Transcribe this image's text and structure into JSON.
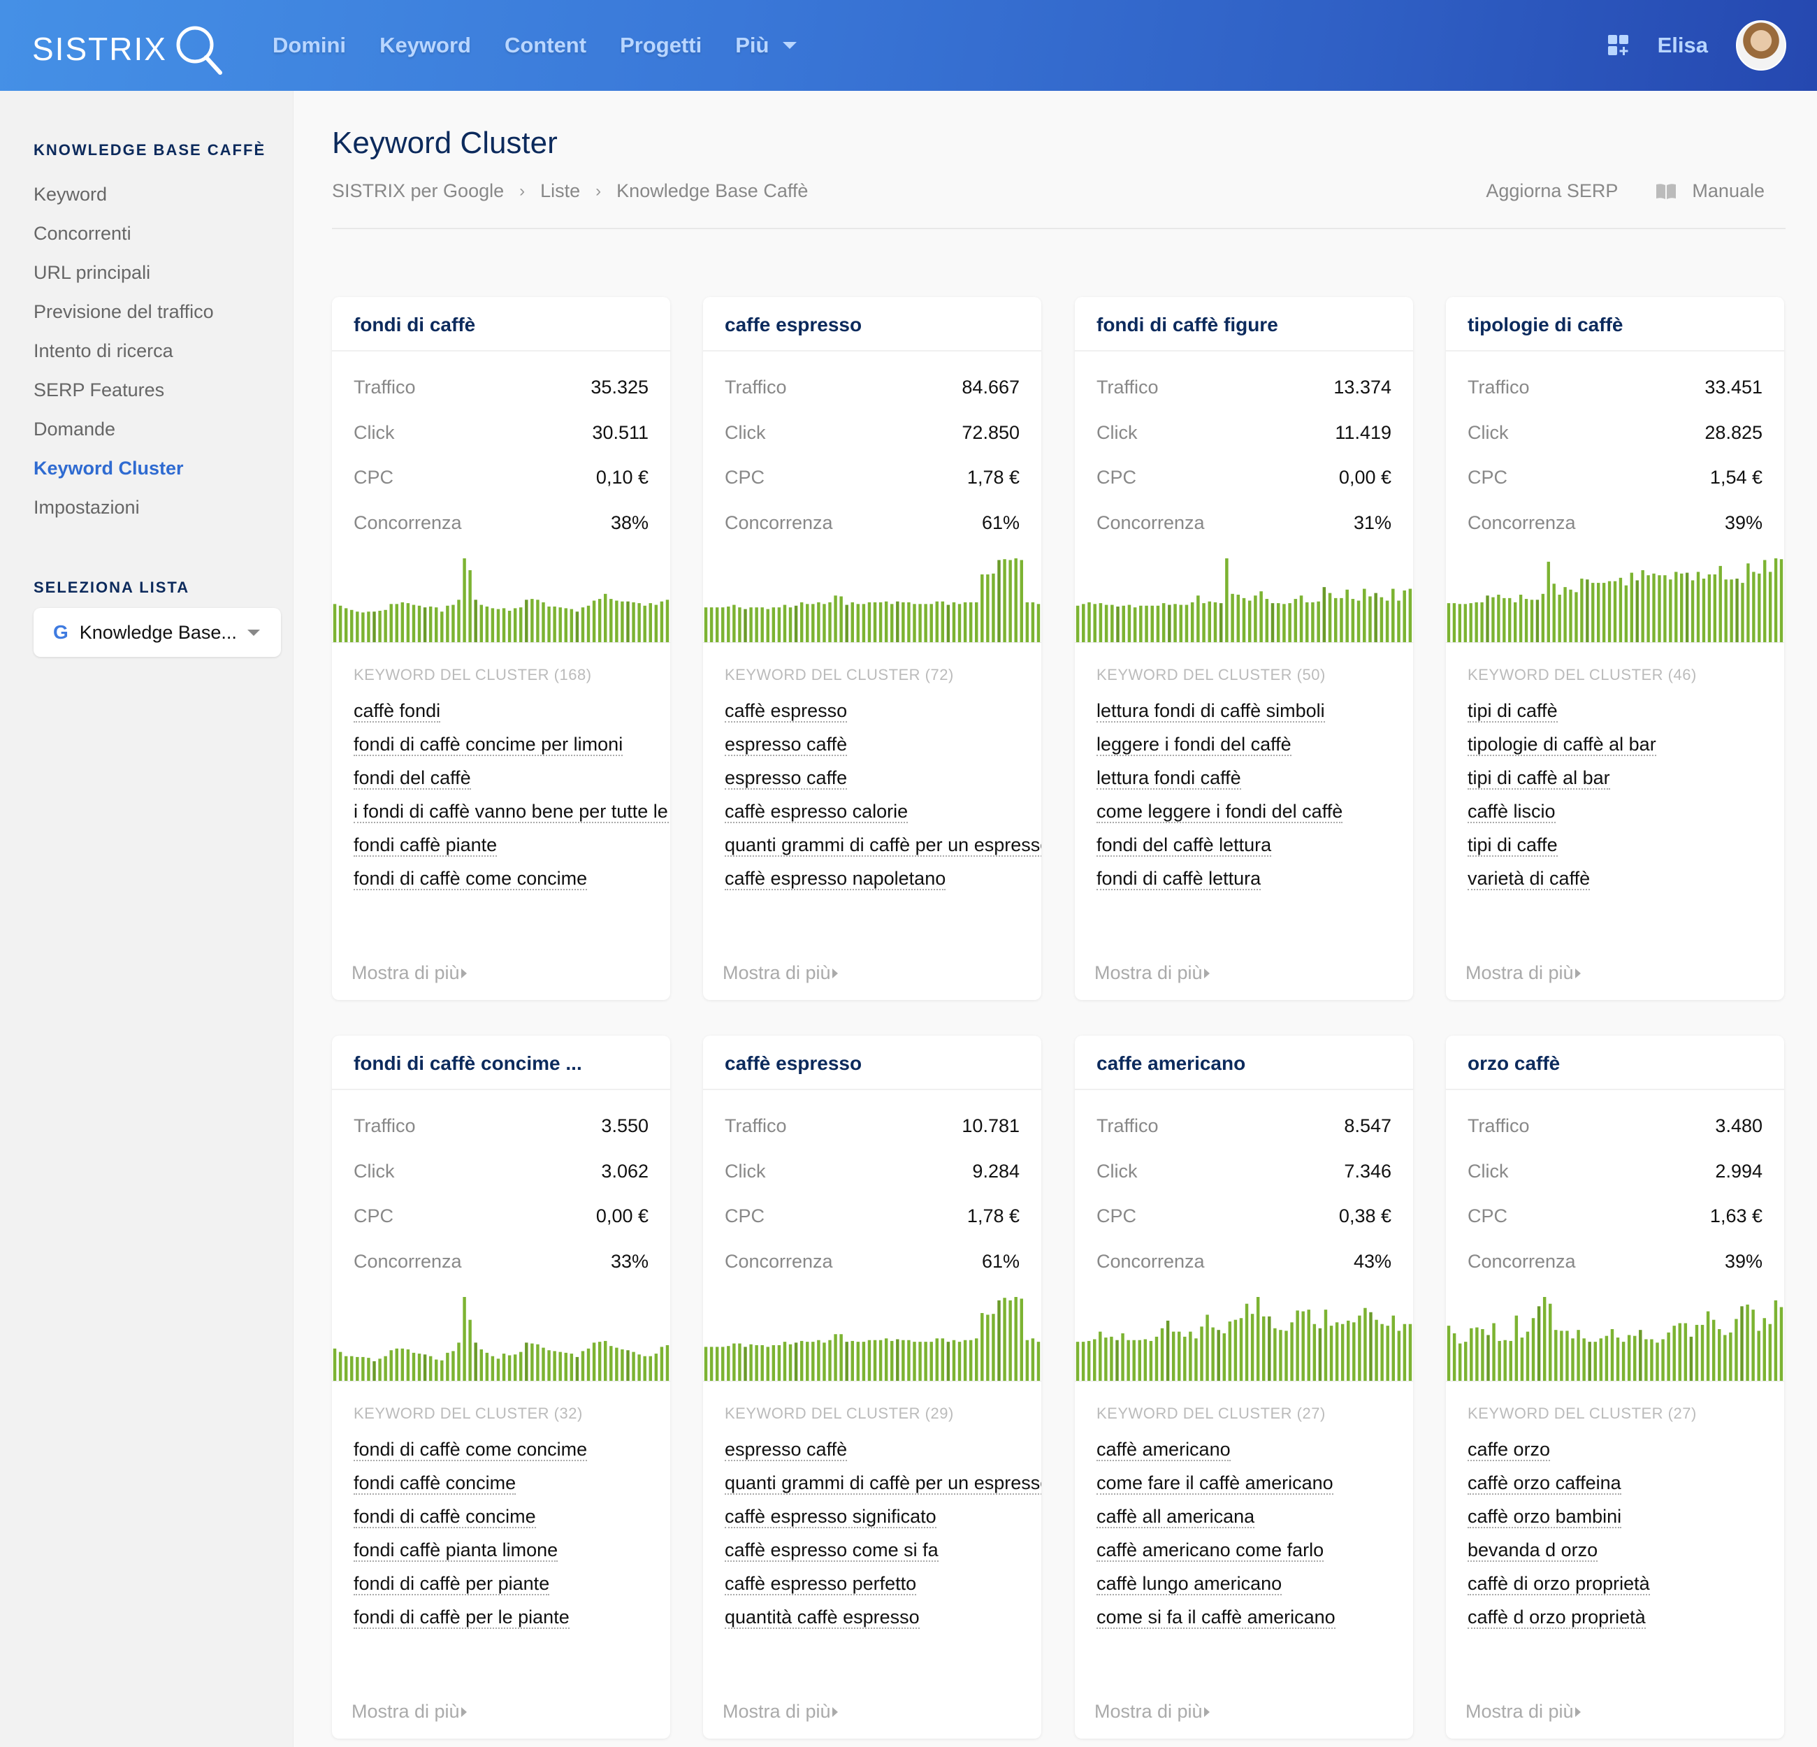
{
  "header": {
    "logo": "SISTRIX",
    "nav": [
      "Domini",
      "Keyword",
      "Content",
      "Progetti"
    ],
    "nav_more": "Più",
    "user_name": "Elisa"
  },
  "sidebar": {
    "project_heading": "KNOWLEDGE BASE CAFFÈ",
    "items": [
      {
        "label": "Keyword",
        "active": false
      },
      {
        "label": "Concorrenti",
        "active": false
      },
      {
        "label": "URL principali",
        "active": false
      },
      {
        "label": "Previsione del traffico",
        "active": false
      },
      {
        "label": "Intento di ricerca",
        "active": false
      },
      {
        "label": "SERP Features",
        "active": false
      },
      {
        "label": "Domande",
        "active": false
      },
      {
        "label": "Keyword Cluster",
        "active": true
      },
      {
        "label": "Impostazioni",
        "active": false
      }
    ],
    "list_heading": "SELEZIONA LISTA",
    "list_select": {
      "icon": "G",
      "value": "Knowledge Base..."
    }
  },
  "page": {
    "title": "Keyword Cluster",
    "breadcrumb": [
      "SISTRIX per Google",
      "Liste",
      "Knowledge Base Caffè"
    ],
    "actions": {
      "refresh": "Aggiorna SERP",
      "manual": "Manuale"
    }
  },
  "labels": {
    "traffic": "Traffico",
    "clicks": "Click",
    "cpc": "CPC",
    "competition": "Concorrenza",
    "show_more": "Mostra di più"
  },
  "colors": {
    "bar": "#7cb332",
    "bar_dark": "#6a9a2a",
    "accent": "#2f6bd1",
    "title": "#0c2a5c"
  },
  "clusters": [
    {
      "title": "fondi di caffè",
      "traffic": "35.325",
      "clicks": "30.511",
      "cpc": "0,10 €",
      "competition": "38%",
      "keywords_header": "KEYWORD DEL CLUSTER (168)",
      "keywords": [
        "caffè fondi",
        "fondi di caffè concime per limoni",
        "fondi del caffè",
        "i fondi di caffè vanno bene per tutte le piante",
        "fondi caffè piante",
        "fondi di caffè come concime"
      ],
      "trend": [
        0.46,
        0.44,
        0.41,
        0.39,
        0.37,
        0.36,
        0.37,
        0.37,
        0.38,
        0.39,
        0.46,
        0.46,
        0.48,
        0.47,
        0.45,
        0.44,
        0.42,
        0.43,
        0.42,
        0.37,
        0.44,
        0.45,
        0.51,
        1.0,
        0.86,
        0.51,
        0.45,
        0.43,
        0.41,
        0.4,
        0.41,
        0.38,
        0.41,
        0.42,
        0.51,
        0.52,
        0.51,
        0.48,
        0.43,
        0.43,
        0.42,
        0.41,
        0.4,
        0.37,
        0.42,
        0.44,
        0.5,
        0.52,
        0.58,
        0.52,
        0.5,
        0.49,
        0.49,
        0.48,
        0.47,
        0.44,
        0.47,
        0.45,
        0.49,
        0.51
      ]
    },
    {
      "title": "caffe espresso",
      "traffic": "84.667",
      "clicks": "72.850",
      "cpc": "1,78 €",
      "competition": "61%",
      "keywords_header": "KEYWORD DEL CLUSTER (72)",
      "keywords": [
        "caffè espresso",
        "espresso caffè",
        "espresso caffe",
        "caffè espresso calorie",
        "quanti grammi di caffè per un espresso",
        "caffè espresso napoletano"
      ],
      "trend": [
        0.42,
        0.42,
        0.42,
        0.42,
        0.43,
        0.45,
        0.42,
        0.4,
        0.42,
        0.42,
        0.42,
        0.4,
        0.42,
        0.42,
        0.45,
        0.42,
        0.44,
        0.48,
        0.46,
        0.46,
        0.48,
        0.46,
        0.48,
        0.56,
        0.55,
        0.45,
        0.48,
        0.46,
        0.46,
        0.48,
        0.48,
        0.48,
        0.49,
        0.46,
        0.49,
        0.48,
        0.48,
        0.46,
        0.46,
        0.46,
        0.46,
        0.49,
        0.49,
        0.45,
        0.48,
        0.46,
        0.48,
        0.48,
        0.48,
        0.81,
        0.81,
        0.82,
        0.98,
        0.99,
        0.98,
        1.0,
        0.98,
        0.48,
        0.48,
        0.46
      ]
    },
    {
      "title": "fondi di caffè figure",
      "traffic": "13.374",
      "clicks": "11.419",
      "cpc": "0,00 €",
      "competition": "31%",
      "keywords_header": "KEYWORD DEL CLUSTER (50)",
      "keywords": [
        "lettura fondi di caffè simboli",
        "leggere i fondi del caffè",
        "lettura fondi caffè",
        "come leggere i fondi del caffè",
        "fondi del caffè lettura",
        "fondi di caffè lettura"
      ],
      "trend": [
        0.44,
        0.46,
        0.48,
        0.46,
        0.47,
        0.45,
        0.45,
        0.43,
        0.44,
        0.45,
        0.42,
        0.44,
        0.44,
        0.44,
        0.44,
        0.47,
        0.45,
        0.46,
        0.45,
        0.45,
        0.48,
        0.56,
        0.47,
        0.49,
        0.48,
        0.47,
        1.0,
        0.58,
        0.57,
        0.53,
        0.5,
        0.56,
        0.61,
        0.52,
        0.47,
        0.47,
        0.46,
        0.47,
        0.52,
        0.56,
        0.48,
        0.48,
        0.49,
        0.66,
        0.59,
        0.53,
        0.53,
        0.63,
        0.52,
        0.5,
        0.64,
        0.55,
        0.59,
        0.54,
        0.5,
        0.64,
        0.5,
        0.62,
        0.64
      ]
    },
    {
      "title": "tipologie di caffè",
      "traffic": "33.451",
      "clicks": "28.825",
      "cpc": "1,54 €",
      "competition": "39%",
      "keywords_header": "KEYWORD DEL CLUSTER (46)",
      "keywords": [
        "tipi di caffè",
        "tipologie di caffè al bar",
        "tipi di caffè al bar",
        "caffè liscio",
        "tipi di caffe",
        "varietà di caffè"
      ],
      "trend": [
        0.47,
        0.47,
        0.46,
        0.46,
        0.47,
        0.48,
        0.48,
        0.56,
        0.54,
        0.57,
        0.53,
        0.53,
        0.48,
        0.57,
        0.52,
        0.51,
        0.51,
        0.58,
        0.96,
        0.7,
        0.57,
        0.66,
        0.63,
        0.6,
        0.76,
        0.75,
        0.71,
        0.71,
        0.71,
        0.73,
        0.73,
        0.77,
        0.68,
        0.83,
        0.74,
        0.86,
        0.8,
        0.82,
        0.8,
        0.8,
        0.75,
        0.84,
        0.82,
        0.83,
        0.74,
        0.84,
        0.76,
        0.81,
        0.81,
        0.91,
        0.75,
        0.75,
        0.76,
        0.71,
        0.94,
        0.84,
        0.82,
        0.98,
        0.84,
        1.0,
        0.99
      ]
    },
    {
      "title": "fondi di caffè concime ...",
      "traffic": "3.550",
      "clicks": "3.062",
      "cpc": "0,00 €",
      "competition": "33%",
      "keywords_header": "KEYWORD DEL CLUSTER (32)",
      "keywords": [
        "fondi di caffè come concime",
        "fondi caffè concime",
        "fondi di caffè concime",
        "fondi caffè pianta limone",
        "fondi di caffè per piante",
        "fondi di caffè per le piante"
      ],
      "trend": [
        0.39,
        0.35,
        0.3,
        0.3,
        0.29,
        0.29,
        0.28,
        0.24,
        0.27,
        0.3,
        0.37,
        0.39,
        0.39,
        0.38,
        0.34,
        0.33,
        0.32,
        0.3,
        0.26,
        0.25,
        0.34,
        0.36,
        0.46,
        1.0,
        0.73,
        0.46,
        0.38,
        0.34,
        0.3,
        0.27,
        0.33,
        0.31,
        0.32,
        0.35,
        0.46,
        0.45,
        0.44,
        0.4,
        0.37,
        0.36,
        0.35,
        0.34,
        0.33,
        0.29,
        0.36,
        0.39,
        0.46,
        0.47,
        0.48,
        0.42,
        0.4,
        0.38,
        0.37,
        0.35,
        0.32,
        0.3,
        0.3,
        0.33,
        0.41,
        0.43
      ]
    },
    {
      "title": "caffè espresso",
      "traffic": "10.781",
      "clicks": "9.284",
      "cpc": "1,78 €",
      "competition": "61%",
      "keywords_header": "KEYWORD DEL CLUSTER (29)",
      "keywords": [
        "espresso caffè",
        "quanti grammi di caffè per un espresso",
        "caffè espresso significato",
        "caffè espresso come si fa",
        "caffè espresso perfetto",
        "quantità caffè espresso"
      ],
      "trend": [
        0.41,
        0.41,
        0.41,
        0.41,
        0.42,
        0.45,
        0.45,
        0.41,
        0.44,
        0.43,
        0.43,
        0.41,
        0.43,
        0.43,
        0.47,
        0.44,
        0.46,
        0.48,
        0.47,
        0.47,
        0.49,
        0.46,
        0.49,
        0.56,
        0.56,
        0.47,
        0.48,
        0.47,
        0.47,
        0.49,
        0.49,
        0.49,
        0.51,
        0.48,
        0.5,
        0.49,
        0.49,
        0.47,
        0.47,
        0.47,
        0.47,
        0.51,
        0.51,
        0.47,
        0.49,
        0.47,
        0.49,
        0.49,
        0.51,
        0.81,
        0.79,
        0.8,
        0.96,
        0.99,
        0.96,
        1.0,
        0.98,
        0.49,
        0.51,
        0.47
      ]
    },
    {
      "title": "caffe americano",
      "traffic": "8.547",
      "clicks": "7.346",
      "cpc": "0,38 €",
      "competition": "43%",
      "keywords_header": "KEYWORD DEL CLUSTER (27)",
      "keywords": [
        "caffè americano",
        "come fare il caffè americano",
        "caffè all americana",
        "caffè americano come farlo",
        "caffè lungo americano",
        "come si fa il caffè americano"
      ],
      "trend": [
        0.47,
        0.47,
        0.48,
        0.5,
        0.59,
        0.52,
        0.53,
        0.49,
        0.57,
        0.49,
        0.49,
        0.49,
        0.5,
        0.48,
        0.53,
        0.63,
        0.72,
        0.59,
        0.59,
        0.53,
        0.59,
        0.51,
        0.65,
        0.79,
        0.64,
        0.61,
        0.57,
        0.71,
        0.73,
        0.75,
        0.92,
        0.8,
        1.0,
        0.77,
        0.77,
        0.63,
        0.61,
        0.6,
        0.7,
        0.84,
        0.83,
        0.85,
        0.68,
        0.63,
        0.85,
        0.66,
        0.7,
        0.68,
        0.72,
        0.7,
        0.78,
        0.87,
        0.82,
        0.73,
        0.68,
        0.66,
        0.78,
        0.6,
        0.68,
        0.68
      ]
    },
    {
      "title": "orzo caffè",
      "traffic": "3.480",
      "clicks": "2.994",
      "cpc": "1,63 €",
      "competition": "39%",
      "keywords_header": "KEYWORD DEL CLUSTER (27)",
      "keywords": [
        "caffe orzo",
        "caffè orzo caffeina",
        "caffè orzo bambini",
        "bevanda d orzo",
        "caffè di orzo proprietà",
        "caffè d orzo proprietà"
      ],
      "trend": [
        0.66,
        0.57,
        0.45,
        0.47,
        0.63,
        0.64,
        0.62,
        0.55,
        0.69,
        0.48,
        0.49,
        0.48,
        0.78,
        0.52,
        0.59,
        0.75,
        0.89,
        1.0,
        0.92,
        0.61,
        0.6,
        0.6,
        0.51,
        0.61,
        0.51,
        0.47,
        0.47,
        0.51,
        0.54,
        0.62,
        0.52,
        0.47,
        0.55,
        0.54,
        0.61,
        0.5,
        0.5,
        0.46,
        0.5,
        0.58,
        0.66,
        0.69,
        0.69,
        0.53,
        0.67,
        0.67,
        0.83,
        0.73,
        0.62,
        0.55,
        0.58,
        0.74,
        0.89,
        0.91,
        0.85,
        0.6,
        0.75,
        0.68,
        0.96,
        0.88
      ]
    }
  ]
}
